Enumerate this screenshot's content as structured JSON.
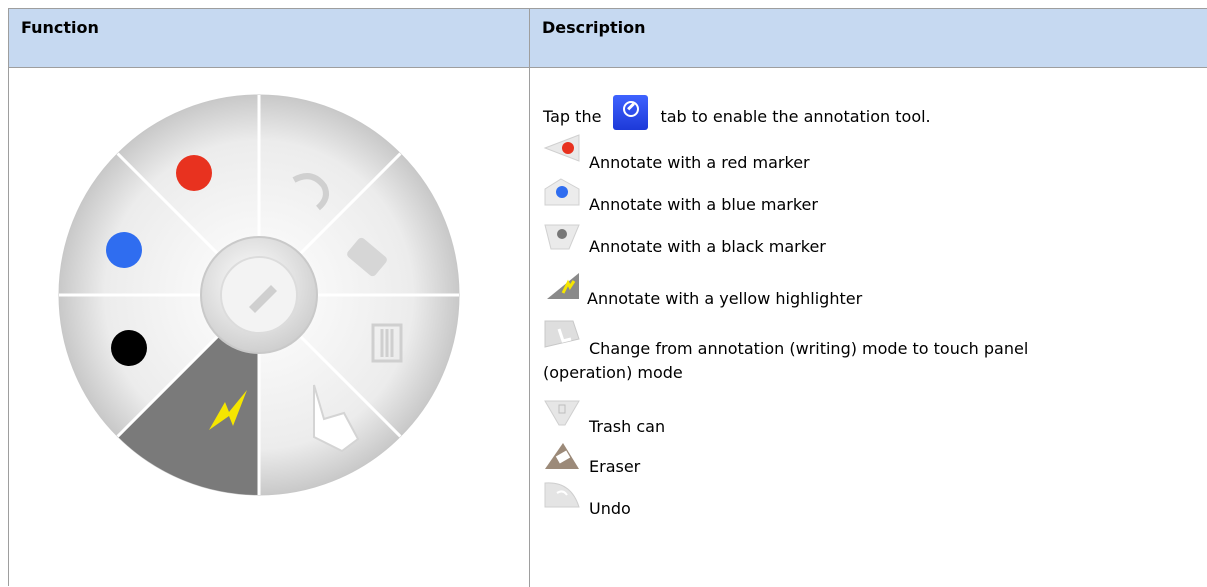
{
  "table": {
    "headers": [
      "Function",
      "Description"
    ]
  },
  "wheel": {
    "center_icon": "pen-icon",
    "segments": [
      {
        "icon": "red-marker-dot",
        "color": "#e8321f"
      },
      {
        "icon": "undo-icon"
      },
      {
        "icon": "eraser-icon"
      },
      {
        "icon": "trash-icon"
      },
      {
        "icon": "hand-touch-icon"
      },
      {
        "icon": "highlighter-icon",
        "color": "#f5e600"
      },
      {
        "icon": "black-marker-dot",
        "color": "#000000"
      },
      {
        "icon": "blue-marker-dot",
        "color": "#2f6df0"
      }
    ]
  },
  "description": {
    "intro_before": "Tap the",
    "intro_icon": "annotation-tab-icon",
    "intro_after": "tab to enable the annotation tool.",
    "items": [
      {
        "icon": "red-marker-icon",
        "text": "Annotate with a red marker"
      },
      {
        "icon": "blue-marker-icon",
        "text": "Annotate with a blue marker"
      },
      {
        "icon": "black-marker-icon",
        "text": "Annotate with a black marker"
      },
      {
        "icon": "yellow-highlighter-icon",
        "text": "Annotate with a yellow highlighter"
      },
      {
        "icon": "touch-mode-icon",
        "text": "Change from annotation (writing) mode to touch panel",
        "text2": "(operation) mode"
      },
      {
        "icon": "trash-can-icon",
        "text": "Trash can"
      },
      {
        "icon": "eraser-icon",
        "text": "Eraser"
      },
      {
        "icon": "undo-icon",
        "text": "Undo"
      }
    ],
    "colors": {
      "header_bg": "#c6d9f1",
      "red": "#e8321f",
      "blue": "#2f6df0",
      "yellow": "#f5e600"
    }
  }
}
